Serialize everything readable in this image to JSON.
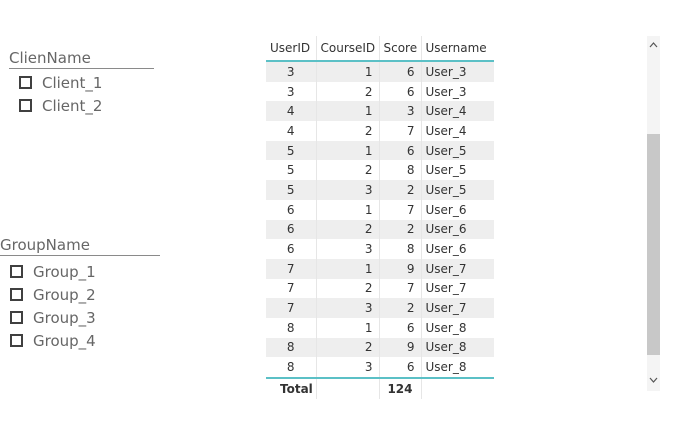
{
  "slicers": {
    "client": {
      "title": "ClienName",
      "items": [
        "Client_1",
        "Client_2"
      ]
    },
    "group": {
      "title": "GroupName",
      "items": [
        "Group_1",
        "Group_2",
        "Group_3",
        "Group_4"
      ]
    }
  },
  "table": {
    "headers": [
      "UserID",
      "CourseID",
      "Score",
      "Username"
    ],
    "rows": [
      [
        "3",
        "1",
        "6",
        "User_3"
      ],
      [
        "3",
        "2",
        "6",
        "User_3"
      ],
      [
        "4",
        "1",
        "3",
        "User_4"
      ],
      [
        "4",
        "2",
        "7",
        "User_4"
      ],
      [
        "5",
        "1",
        "6",
        "User_5"
      ],
      [
        "5",
        "2",
        "8",
        "User_5"
      ],
      [
        "5",
        "3",
        "2",
        "User_5"
      ],
      [
        "6",
        "1",
        "7",
        "User_6"
      ],
      [
        "6",
        "2",
        "2",
        "User_6"
      ],
      [
        "6",
        "3",
        "8",
        "User_6"
      ],
      [
        "7",
        "1",
        "9",
        "User_7"
      ],
      [
        "7",
        "2",
        "7",
        "User_7"
      ],
      [
        "7",
        "3",
        "2",
        "User_7"
      ],
      [
        "8",
        "1",
        "6",
        "User_8"
      ],
      [
        "8",
        "2",
        "9",
        "User_8"
      ],
      [
        "8",
        "3",
        "6",
        "User_8"
      ]
    ],
    "total_label": "Total",
    "total_score": "124"
  },
  "colors": {
    "accent": "#5bc0c6",
    "row_alt": "#eeeeee",
    "scroll_thumb": "#c8c8c8"
  },
  "icons": {
    "scroll_up": "chevron-up-icon",
    "scroll_down": "chevron-down-icon"
  }
}
